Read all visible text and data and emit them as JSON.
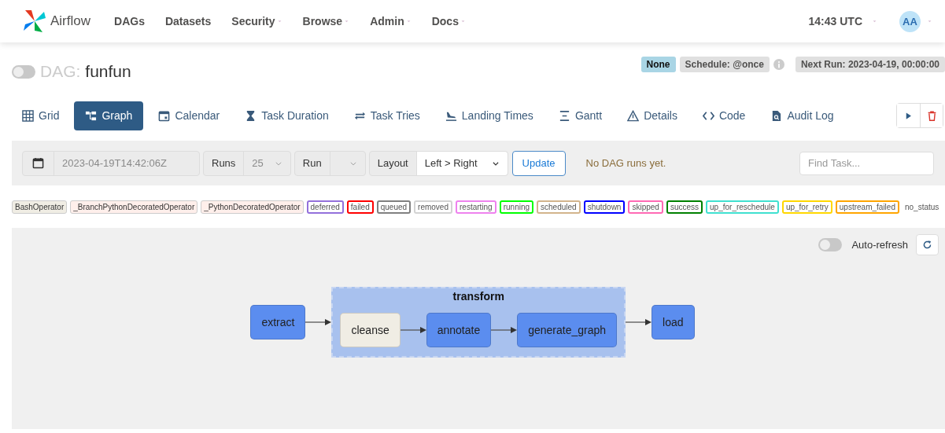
{
  "navbar": {
    "brand": "Airflow",
    "menu": [
      {
        "label": "DAGs",
        "dropdown": false
      },
      {
        "label": "Datasets",
        "dropdown": false
      },
      {
        "label": "Security",
        "dropdown": true
      },
      {
        "label": "Browse",
        "dropdown": true
      },
      {
        "label": "Admin",
        "dropdown": true
      },
      {
        "label": "Docs",
        "dropdown": true
      }
    ],
    "time": "14:43 UTC",
    "user": "AA"
  },
  "dag": {
    "active": false,
    "prefix": "DAG:",
    "name": "funfun",
    "badges": [
      {
        "kind": "owner",
        "text": "None"
      },
      {
        "kind": "schedule",
        "text": "Schedule: @once"
      },
      {
        "kind": "info"
      },
      {
        "kind": "next",
        "text": "Next Run: 2023-04-19, 00:00:00"
      }
    ]
  },
  "tabs": [
    {
      "label": "Grid",
      "kind": "grid",
      "selected": false
    },
    {
      "label": "Graph",
      "kind": "graph",
      "selected": true
    },
    {
      "label": "Calendar",
      "kind": "calendar",
      "selected": false
    },
    {
      "label": "Task Duration",
      "kind": "duration",
      "selected": false
    },
    {
      "label": "Task Tries",
      "kind": "tries",
      "selected": false
    },
    {
      "label": "Landing Times",
      "kind": "landing",
      "selected": false
    },
    {
      "label": "Gantt",
      "kind": "gantt",
      "selected": false
    },
    {
      "label": "Details",
      "kind": "details",
      "selected": false
    },
    {
      "label": "Code",
      "kind": "code",
      "selected": false
    },
    {
      "label": "Audit Log",
      "kind": "audit",
      "selected": false
    }
  ],
  "toolbar": {
    "date": "2023-04-19T14:42:06Z",
    "runs_label": "Runs",
    "runs_value": "25",
    "run_label": "Run",
    "layout_label": "Layout",
    "layout_value": "Left > Right",
    "update": "Update",
    "message": "No DAG runs yet.",
    "search_placeholder": "Find Task..."
  },
  "legend": [
    {
      "label": "BashOperator",
      "kind": "operator",
      "color": "#f0ede4"
    },
    {
      "label": "_BranchPythonDecoratedOperator",
      "kind": "operator",
      "color": "#ffefeb"
    },
    {
      "label": "_PythonDecoratedOperator",
      "kind": "operator",
      "color": "#ffefeb"
    },
    {
      "label": "deferred",
      "kind": "state",
      "color": "#9370db"
    },
    {
      "label": "failed",
      "kind": "state",
      "color": "#ff0000"
    },
    {
      "label": "queued",
      "kind": "state",
      "color": "#808080"
    },
    {
      "label": "removed",
      "kind": "state",
      "color": "#d3d3d3"
    },
    {
      "label": "restarting",
      "kind": "state",
      "color": "#ee82ee"
    },
    {
      "label": "running",
      "kind": "state",
      "color": "#00ff00"
    },
    {
      "label": "scheduled",
      "kind": "state",
      "color": "#d2b48c"
    },
    {
      "label": "shutdown",
      "kind": "state",
      "color": "#0000ff"
    },
    {
      "label": "skipped",
      "kind": "state",
      "color": "#ff69b4"
    },
    {
      "label": "success",
      "kind": "state",
      "color": "#008000"
    },
    {
      "label": "up_for_reschedule",
      "kind": "state",
      "color": "#40e0d0"
    },
    {
      "label": "up_for_retry",
      "kind": "state",
      "color": "#ffd700"
    },
    {
      "label": "upstream_failed",
      "kind": "state",
      "color": "#ffa500"
    },
    {
      "label": "no_status",
      "kind": "none"
    }
  ],
  "graph": {
    "auto_refresh": {
      "label": "Auto-refresh",
      "on": false
    },
    "nodes": [
      {
        "kind": "task",
        "label": "extract",
        "color": "#5b8def"
      },
      {
        "kind": "group",
        "label": "transform",
        "children": [
          {
            "kind": "task",
            "label": "cleanse",
            "color": "#f0ede4"
          },
          {
            "kind": "task",
            "label": "annotate",
            "color": "#5b8def"
          },
          {
            "kind": "task",
            "label": "generate_graph",
            "color": "#5b8def"
          }
        ]
      },
      {
        "kind": "task",
        "label": "load",
        "color": "#5b8def"
      }
    ]
  }
}
